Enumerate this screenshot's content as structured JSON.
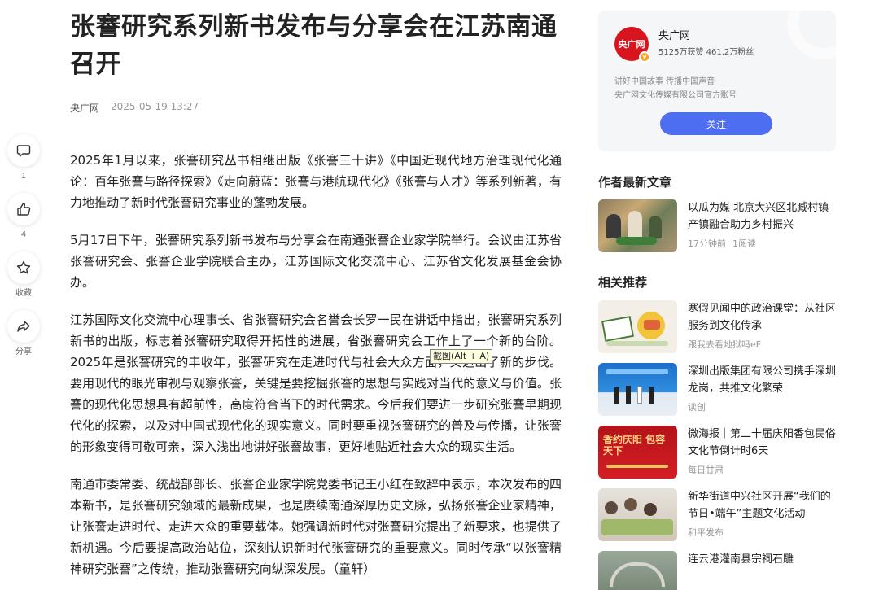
{
  "article": {
    "title": "张謇研究系列新书发布与分享会在江苏南通召开",
    "source": "央广网",
    "time": "2025-05-19 13:27",
    "paragraphs": [
      "2025年1月以来，张謇研究丛书相继出版《张謇三十讲》《中国近现代地方治理现代化通论：百年张謇与路径探索》《走向蔚蓝：张謇与港航现代化》《张謇与人才》等系列新著，有力地推动了新时代张謇研究事业的蓬勃发展。",
      "5月17日下午，张謇研究系列新书发布与分享会在南通张謇企业家学院举行。会议由江苏省张謇研究会、张謇企业学院联合主办，江苏国际文化交流中心、江苏省文化发展基金会协办。",
      "江苏国际文化交流中心理事长、省张謇研究会名誉会长罗一民在讲话中指出，张謇研究系列新书的出版，标志着张謇研究取得开拓性的进展，省张謇研究会工作上了一个新的台阶。2025年是张謇研究的丰收年，张謇研究在走进时代与社会大众方面，又迈出了新的步伐。要用现代的眼光审视与观察张謇，关键是要挖掘张謇的思想与实践对当代的意义与价值。张謇的现代化思想具有超前性，高度符合当下的时代需求。今后我们要进一步研究张謇早期现代化的探索，以及对中国式现代化的现实意义。同时要重视张謇研究的普及与传播，让张謇的形象变得可敬可亲，深入浅出地讲好张謇故事，更好地贴近社会大众的现实生活。",
      "南通市委常委、统战部部长、张謇企业家学院党委书记王小红在致辞中表示，本次发布的四本新书，是张謇研究领域的最新成果，也是赓续南通深厚历史文脉，弘扬张謇企业家精神，让张謇走进时代、走进大众的重要载体。她强调新时代对张謇研究提出了新要求，也提供了新机遇。今后要提高政治站位，深刻认识新时代张謇研究的重要意义。同时传承“以张謇精神研究张謇”之传统，推动张謇研究向纵深发展。（童轩）"
    ]
  },
  "tooltip": "截图(Alt + A)",
  "actions": [
    {
      "icon": "comment-icon",
      "label": "1"
    },
    {
      "icon": "like-icon",
      "label": "4"
    },
    {
      "icon": "star-icon",
      "label": "收藏"
    },
    {
      "icon": "share-icon",
      "label": "分享"
    }
  ],
  "author": {
    "name": "央广网",
    "avatar_text": "央广网",
    "stats": "5125万获赞 461.2万粉丝",
    "desc_line1": "讲好中国故事 传播中国声音",
    "desc_line2": "央广网文化传媒有限公司官方账号",
    "follow_label": "关注",
    "accent": "#4e6ef2",
    "brand": "#d8141e"
  },
  "latest": {
    "heading": "作者最新文章",
    "items": [
      {
        "title": "以瓜为媒 北京大兴区北臧村镇产镇融合助力乡村振兴",
        "src": "17分钟前",
        "extra": "1阅读"
      }
    ]
  },
  "related": {
    "heading": "相关推荐",
    "items": [
      {
        "title": "寒假见闻中的政治课堂：从社区服务到文化传承",
        "src": "跟我去看地狱吗eF"
      },
      {
        "title": "深圳出版集团有限公司携手深圳龙岗，共推文化繁荣",
        "src": "读创"
      },
      {
        "title": "微海报｜第二十届庆阳香包民俗文化节倒计时6天",
        "src": "每日甘肃",
        "thumb_text": "香约庆阳 包容天下"
      },
      {
        "title": "新华街道中兴社区开展“我们的节日•端午”主题文化活动",
        "src": "和平发布"
      },
      {
        "title": "连云港灌南县宗祠石雕",
        "src": ""
      }
    ]
  }
}
